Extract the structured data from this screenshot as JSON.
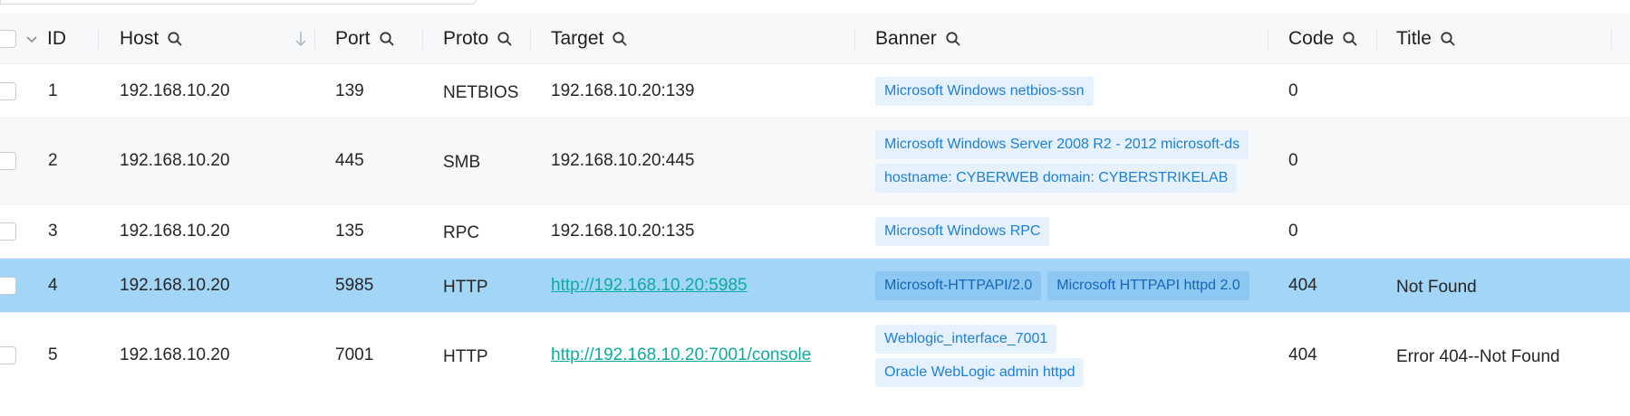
{
  "columns": {
    "id": "ID",
    "host": "Host",
    "port": "Port",
    "proto": "Proto",
    "target": "Target",
    "banner": "Banner",
    "code": "Code",
    "title": "Title"
  },
  "rows": [
    {
      "id": "1",
      "host": "192.168.10.20",
      "port": "139",
      "proto": "NETBIOS",
      "target": "192.168.10.20:139",
      "banner": [
        "Microsoft Windows netbios-ssn"
      ],
      "code": "0",
      "title": ""
    },
    {
      "id": "2",
      "host": "192.168.10.20",
      "port": "445",
      "proto": "SMB",
      "target": "192.168.10.20:445",
      "banner": [
        "Microsoft Windows Server 2008 R2 - 2012 microsoft-ds",
        "hostname: CYBERWEB domain: CYBERSTRIKELAB"
      ],
      "code": "0",
      "title": ""
    },
    {
      "id": "3",
      "host": "192.168.10.20",
      "port": "135",
      "proto": "RPC",
      "target": "192.168.10.20:135",
      "banner": [
        "Microsoft Windows RPC"
      ],
      "code": "0",
      "title": ""
    },
    {
      "id": "4",
      "host": "192.168.10.20",
      "port": "5985",
      "proto": "HTTP",
      "target": "http://192.168.10.20:5985",
      "banner": [
        "Microsoft-HTTPAPI/2.0",
        "Microsoft HTTPAPI httpd 2.0"
      ],
      "code": "404",
      "title": "Not Found"
    },
    {
      "id": "5",
      "host": "192.168.10.20",
      "port": "7001",
      "proto": "HTTP",
      "target": "http://192.168.10.20:7001/console",
      "banner": [
        "Weblogic_interface_7001",
        "Oracle WebLogic admin httpd"
      ],
      "code": "404",
      "title": "Error 404--Not Found"
    }
  ],
  "colors": {
    "header_bg": "#f7f8fa",
    "selected_row_bg": "#a3d5f7",
    "tag_bg": "#e5f1fc",
    "tag_text": "#1e7fd8",
    "link": "#0eaaa2"
  },
  "icons": {
    "filter": "search-icon",
    "sort": "sort-arrow-down-icon",
    "expand": "chevron-down-icon"
  }
}
